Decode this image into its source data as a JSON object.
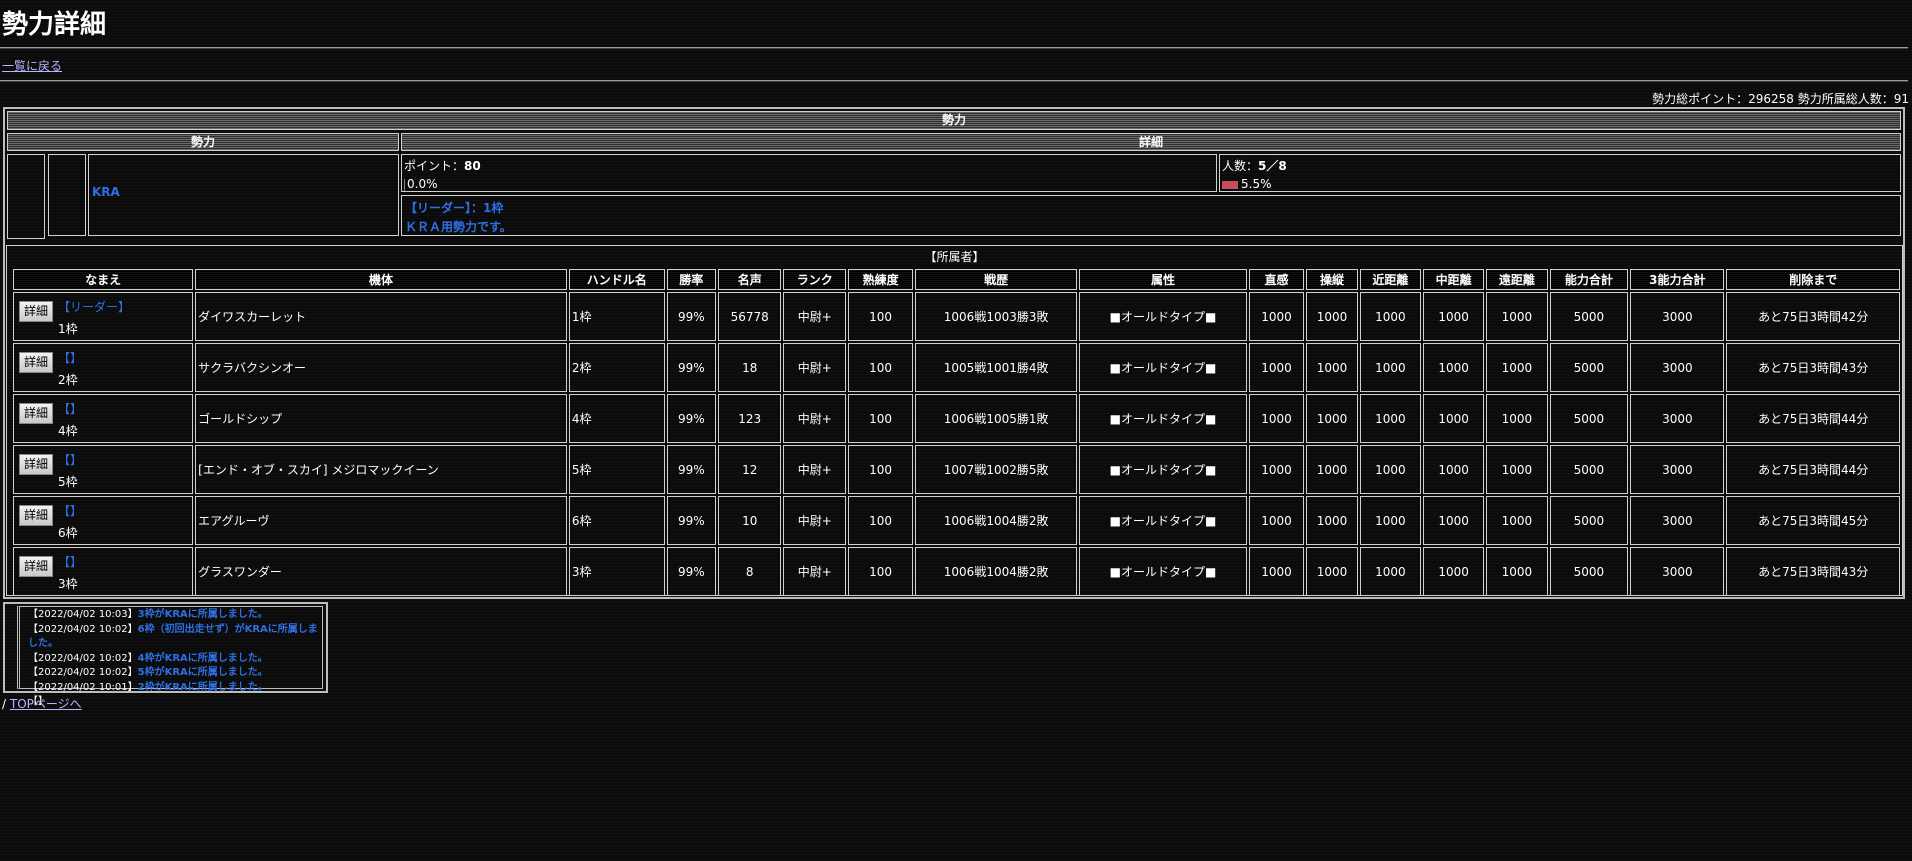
{
  "page": {
    "title": "勢力詳細",
    "back_link": "一覧に戻る",
    "totals": "勢力総ポイント：296258 勢力所属総人数：91"
  },
  "faction": {
    "section_header": "勢力",
    "col_faction": "勢力",
    "col_detail": "詳細",
    "name": "KRA",
    "points_label": "ポイント：",
    "points_value": "80",
    "points_pct": "0.0%",
    "members_label": "人数：",
    "members_value": "5／8",
    "members_pct": "5.5%",
    "leader_line": "【リーダー】：1枠",
    "description": "ＫＲＡ用勢力です。"
  },
  "members_section": {
    "header": "【所属者】",
    "columns": [
      "なまえ",
      "機体",
      "ハンドル名",
      "勝率",
      "名声",
      "ランク",
      "熟練度",
      "戦歴",
      "属性",
      "直感",
      "操縦",
      "近距離",
      "中距離",
      "遠距離",
      "能力合計",
      "3能力合計",
      "削除まで"
    ],
    "detail_button": "詳細",
    "rows": [
      {
        "title": "【リーダー】",
        "handle_name": "1枠",
        "unit": "ダイワスカーレット",
        "handle": "1枠",
        "winrate": "99%",
        "fame": "56778",
        "rank": "中尉+",
        "skill": "100",
        "record": "1006戦1003勝3敗",
        "attr": "■オールドタイプ■",
        "intuition": "1000",
        "control": "1000",
        "near": "1000",
        "mid": "1000",
        "far": "1000",
        "total": "5000",
        "total3": "3000",
        "delete": "あと75日3時間42分"
      },
      {
        "title": "【】",
        "handle_name": "2枠",
        "unit": "サクラバクシンオー",
        "handle": "2枠",
        "winrate": "99%",
        "fame": "18",
        "rank": "中尉+",
        "skill": "100",
        "record": "1005戦1001勝4敗",
        "attr": "■オールドタイプ■",
        "intuition": "1000",
        "control": "1000",
        "near": "1000",
        "mid": "1000",
        "far": "1000",
        "total": "5000",
        "total3": "3000",
        "delete": "あと75日3時間43分"
      },
      {
        "title": "【】",
        "handle_name": "4枠",
        "unit": "ゴールドシップ",
        "handle": "4枠",
        "winrate": "99%",
        "fame": "123",
        "rank": "中尉+",
        "skill": "100",
        "record": "1006戦1005勝1敗",
        "attr": "■オールドタイプ■",
        "intuition": "1000",
        "control": "1000",
        "near": "1000",
        "mid": "1000",
        "far": "1000",
        "total": "5000",
        "total3": "3000",
        "delete": "あと75日3時間44分"
      },
      {
        "title": "【】",
        "handle_name": "5枠",
        "unit": "[エンド・オブ・スカイ] メジロマックイーン",
        "handle": "5枠",
        "winrate": "99%",
        "fame": "12",
        "rank": "中尉+",
        "skill": "100",
        "record": "1007戦1002勝5敗",
        "attr": "■オールドタイプ■",
        "intuition": "1000",
        "control": "1000",
        "near": "1000",
        "mid": "1000",
        "far": "1000",
        "total": "5000",
        "total3": "3000",
        "delete": "あと75日3時間44分"
      },
      {
        "title": "【】",
        "handle_name": "6枠",
        "unit": "エアグルーヴ",
        "handle": "6枠",
        "winrate": "99%",
        "fame": "10",
        "rank": "中尉+",
        "skill": "100",
        "record": "1006戦1004勝2敗",
        "attr": "■オールドタイプ■",
        "intuition": "1000",
        "control": "1000",
        "near": "1000",
        "mid": "1000",
        "far": "1000",
        "total": "5000",
        "total3": "3000",
        "delete": "あと75日3時間45分"
      },
      {
        "title": "【】",
        "handle_name": "3枠",
        "unit": "グラスワンダー",
        "handle": "3枠",
        "winrate": "99%",
        "fame": "8",
        "rank": "中尉+",
        "skill": "100",
        "record": "1006戦1004勝2敗",
        "attr": "■オールドタイプ■",
        "intuition": "1000",
        "control": "1000",
        "near": "1000",
        "mid": "1000",
        "far": "1000",
        "total": "5000",
        "total3": "3000",
        "delete": "あと75日3時間43分"
      }
    ]
  },
  "log": {
    "entries": [
      {
        "date": "【2022/04/02 10:03】",
        "msg": "3枠がKRAに所属しました。"
      },
      {
        "date": "【2022/04/02 10:02】",
        "msg": "6枠（初回出走せず）がKRAに所属しました。"
      },
      {
        "date": "【2022/04/02 10:02】",
        "msg": "4枠がKRAに所属しました。"
      },
      {
        "date": "【2022/04/02 10:02】",
        "msg": "5枠がKRAに所属しました。"
      },
      {
        "date": "【2022/04/02 10:01】",
        "msg": "2枠がKRAに所属しました。"
      }
    ],
    "tail": "【】"
  },
  "footer": {
    "prefix": "/",
    "top_link": "TOPページへ"
  },
  "colors": {
    "background": "#0b0b0b",
    "accent_blue": "#2f6fe6",
    "link": "#b7b7ff",
    "member_bar": "#c94b5e"
  }
}
